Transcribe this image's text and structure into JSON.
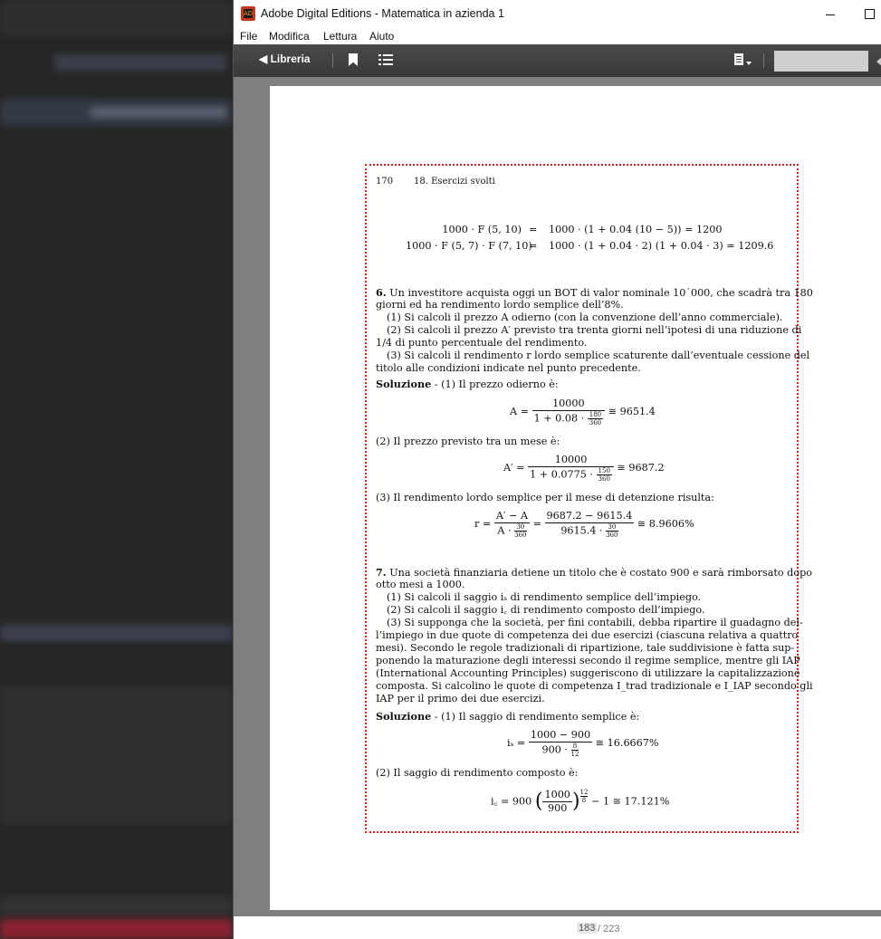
{
  "window": {
    "title": "Adobe Digital Editions - Matematica in azienda 1",
    "icon_text": "AD"
  },
  "menu": [
    "File",
    "Modifica",
    "Lettura",
    "Aiuto"
  ],
  "toolbar": {
    "library_label": "◀ Libreria",
    "icons": [
      "bookmark-icon",
      "list-icon",
      "document-icon",
      "search-field"
    ]
  },
  "status": {
    "current_page": "183",
    "total_pages": "/ 223"
  },
  "book": {
    "page_number": "170",
    "running_header": "18.  Esercizi svolti",
    "eq_top": [
      {
        "lhs": "1000 · F (5, 10)",
        "rel": "=",
        "rhs": "1000 · (1 + 0.04 (10 − 5)) = 1200"
      },
      {
        "lhs": "1000 · F (5, 7) · F (7, 10)",
        "rel": "=",
        "rhs": "1000 · (1 + 0.04 · 2) (1 + 0.04 · 3) = 1209.6"
      }
    ],
    "ex6": {
      "number": "6.",
      "lines": [
        "Un investitore acquista oggi un BOT di valor nominale 10˙000, che scadrà tra 180",
        "giorni ed ha rendimento lordo semplice dell’8%.",
        "(1) Si calcoli il prezzo A odierno (con la convenzione dell’anno commerciale).",
        "(2) Si calcoli il prezzo A′ previsto tra trenta giorni nell’ipotesi di una riduzione di",
        "1/4 di punto percentuale del rendimento.",
        "(3) Si calcoli il rendimento r lordo semplice scaturente dall’eventuale cessione del",
        "titolo alle condizioni indicate nel punto precedente."
      ],
      "solution_label": "Soluzione",
      "solution_1": " - (1) Il prezzo odierno è:",
      "eq1": {
        "lhs": "A =",
        "num": "10000",
        "den": "1 + 0.08 · ",
        "dn": "180",
        "dd": "360",
        "res": "≅ 9651.4"
      },
      "text2": "(2) Il prezzo previsto tra un mese è:",
      "eq2": {
        "lhs": "A′ =",
        "num": "10000",
        "den": "1 + 0.0775 · ",
        "dn": "150",
        "dd": "360",
        "res": "≅ 9687.2"
      },
      "text3": "(3) Il rendimento lordo semplice per il mese di detenzione risulta:",
      "eq3": {
        "lhs": "r =",
        "num1": "A′ − A",
        "den1": "A · ",
        "dn1": "30",
        "dd1": "360",
        "eq": "=",
        "num2": "9687.2 − 9615.4",
        "den2": "9615.4 · ",
        "dn2": "30",
        "dd2": "360",
        "res": "≅ 8.9606%"
      }
    },
    "ex7": {
      "number": "7.",
      "lines": [
        "Una società finanziaria detiene un titolo che è costato 900 e sarà rimborsato dopo",
        "otto mesi a 1000.",
        "(1) Si calcoli il saggio iₛ di rendimento semplice dell’impiego.",
        "(2) Si calcoli il saggio i꜀ di rendimento composto dell’impiego.",
        "(3) Si supponga che la società, per fini contabili, debba ripartire il guadagno del-",
        "l’impiego in due quote di competenza dei due esercizi (ciascuna relativa a quattro",
        "mesi). Secondo le regole tradizionali di ripartizione, tale suddivisione è fatta sup-",
        "ponendo la maturazione degli interessi secondo il regime semplice, mentre gli IAP",
        "(International Accounting Principles) suggeriscono di utilizzare la capitalizzazione",
        "composta. Si calcolino le quote di competenza I_trad tradizionale e I_IAP secondo gli",
        "IAP per il primo dei due esercizi."
      ],
      "solution_label": "Soluzione",
      "solution_1": " - (1) Il saggio di rendimento semplice è:",
      "eq1": {
        "lhs": "iₛ =",
        "num": "1000 − 900",
        "den": "900 · ",
        "dn": "8",
        "dd": "12",
        "res": "≅ 16.6667%"
      },
      "text2": "(2) Il saggio di rendimento composto è:",
      "eq2": {
        "lhs": "i꜀ = 900",
        "num": "1000",
        "den": "900",
        "exp_n": "12",
        "exp_d": "8",
        "res": "− 1 ≅ 17.121%"
      }
    }
  }
}
